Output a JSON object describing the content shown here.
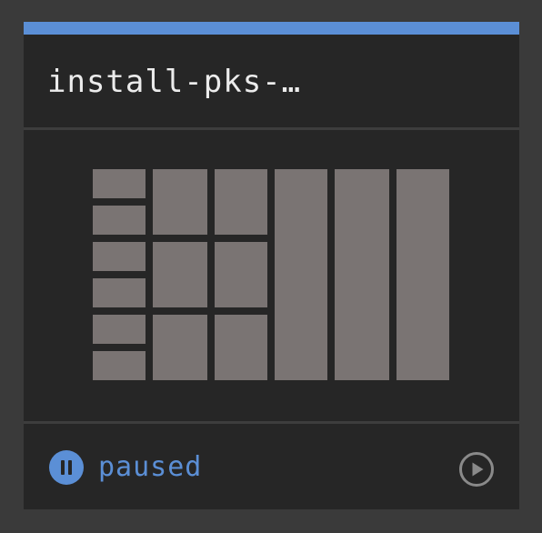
{
  "card": {
    "title": "install-pks-…",
    "accent_color": "#5b8fd6",
    "tile_color": "#7a7473"
  },
  "status": {
    "label": "paused",
    "icon": "pause-icon",
    "color": "#5b8fd6"
  },
  "actions": {
    "play_icon": "play-icon"
  }
}
